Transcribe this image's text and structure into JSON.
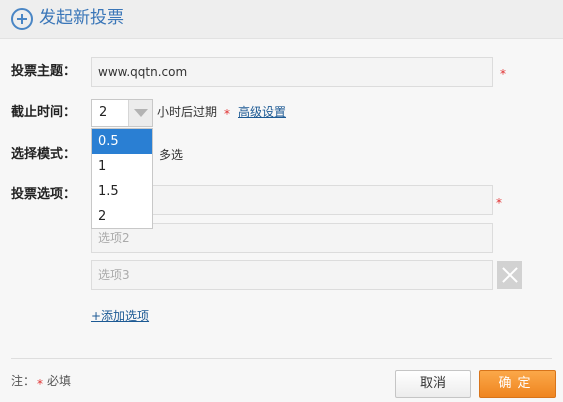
{
  "header": {
    "title": "发起新投票",
    "icon": "plus-circle-icon"
  },
  "topic": {
    "label": "投票主题：",
    "value": "www.qqtn.com",
    "required_mark": "*"
  },
  "deadline": {
    "label": "截止时间：",
    "selected": "2",
    "suffix": "小时后过期",
    "required_mark": "*",
    "advanced_link": "高级设置",
    "options": [
      "0.5",
      "1",
      "1.5",
      "2"
    ],
    "highlighted_option": "0.5"
  },
  "mode": {
    "label": "选择模式：",
    "multi_label": "多选"
  },
  "options": {
    "label": "投票选项：",
    "required_mark": "*",
    "fields": [
      {
        "placeholder": ""
      },
      {
        "placeholder": "选项2"
      },
      {
        "placeholder": "选项3"
      }
    ],
    "add_link": "+添加选项"
  },
  "footer": {
    "note_prefix": "注：",
    "note_mark": "*",
    "note_text": "必填",
    "cancel_label": "取消",
    "confirm_label": "确定"
  },
  "colors": {
    "accent": "#3a76b8",
    "confirm": "#f39a2e",
    "required": "#e03030",
    "highlight": "#2a7fd3"
  }
}
